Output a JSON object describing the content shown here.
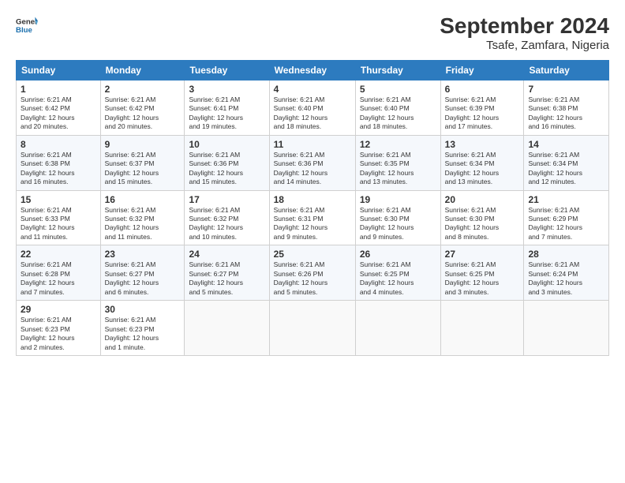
{
  "header": {
    "logo_line1": "General",
    "logo_line2": "Blue",
    "title": "September 2024",
    "subtitle": "Tsafe, Zamfara, Nigeria"
  },
  "columns": [
    "Sunday",
    "Monday",
    "Tuesday",
    "Wednesday",
    "Thursday",
    "Friday",
    "Saturday"
  ],
  "weeks": [
    [
      {
        "day": "1",
        "info": "Sunrise: 6:21 AM\nSunset: 6:42 PM\nDaylight: 12 hours\nand 20 minutes."
      },
      {
        "day": "2",
        "info": "Sunrise: 6:21 AM\nSunset: 6:42 PM\nDaylight: 12 hours\nand 20 minutes."
      },
      {
        "day": "3",
        "info": "Sunrise: 6:21 AM\nSunset: 6:41 PM\nDaylight: 12 hours\nand 19 minutes."
      },
      {
        "day": "4",
        "info": "Sunrise: 6:21 AM\nSunset: 6:40 PM\nDaylight: 12 hours\nand 18 minutes."
      },
      {
        "day": "5",
        "info": "Sunrise: 6:21 AM\nSunset: 6:40 PM\nDaylight: 12 hours\nand 18 minutes."
      },
      {
        "day": "6",
        "info": "Sunrise: 6:21 AM\nSunset: 6:39 PM\nDaylight: 12 hours\nand 17 minutes."
      },
      {
        "day": "7",
        "info": "Sunrise: 6:21 AM\nSunset: 6:38 PM\nDaylight: 12 hours\nand 16 minutes."
      }
    ],
    [
      {
        "day": "8",
        "info": "Sunrise: 6:21 AM\nSunset: 6:38 PM\nDaylight: 12 hours\nand 16 minutes."
      },
      {
        "day": "9",
        "info": "Sunrise: 6:21 AM\nSunset: 6:37 PM\nDaylight: 12 hours\nand 15 minutes."
      },
      {
        "day": "10",
        "info": "Sunrise: 6:21 AM\nSunset: 6:36 PM\nDaylight: 12 hours\nand 15 minutes."
      },
      {
        "day": "11",
        "info": "Sunrise: 6:21 AM\nSunset: 6:36 PM\nDaylight: 12 hours\nand 14 minutes."
      },
      {
        "day": "12",
        "info": "Sunrise: 6:21 AM\nSunset: 6:35 PM\nDaylight: 12 hours\nand 13 minutes."
      },
      {
        "day": "13",
        "info": "Sunrise: 6:21 AM\nSunset: 6:34 PM\nDaylight: 12 hours\nand 13 minutes."
      },
      {
        "day": "14",
        "info": "Sunrise: 6:21 AM\nSunset: 6:34 PM\nDaylight: 12 hours\nand 12 minutes."
      }
    ],
    [
      {
        "day": "15",
        "info": "Sunrise: 6:21 AM\nSunset: 6:33 PM\nDaylight: 12 hours\nand 11 minutes."
      },
      {
        "day": "16",
        "info": "Sunrise: 6:21 AM\nSunset: 6:32 PM\nDaylight: 12 hours\nand 11 minutes."
      },
      {
        "day": "17",
        "info": "Sunrise: 6:21 AM\nSunset: 6:32 PM\nDaylight: 12 hours\nand 10 minutes."
      },
      {
        "day": "18",
        "info": "Sunrise: 6:21 AM\nSunset: 6:31 PM\nDaylight: 12 hours\nand 9 minutes."
      },
      {
        "day": "19",
        "info": "Sunrise: 6:21 AM\nSunset: 6:30 PM\nDaylight: 12 hours\nand 9 minutes."
      },
      {
        "day": "20",
        "info": "Sunrise: 6:21 AM\nSunset: 6:30 PM\nDaylight: 12 hours\nand 8 minutes."
      },
      {
        "day": "21",
        "info": "Sunrise: 6:21 AM\nSunset: 6:29 PM\nDaylight: 12 hours\nand 7 minutes."
      }
    ],
    [
      {
        "day": "22",
        "info": "Sunrise: 6:21 AM\nSunset: 6:28 PM\nDaylight: 12 hours\nand 7 minutes."
      },
      {
        "day": "23",
        "info": "Sunrise: 6:21 AM\nSunset: 6:27 PM\nDaylight: 12 hours\nand 6 minutes."
      },
      {
        "day": "24",
        "info": "Sunrise: 6:21 AM\nSunset: 6:27 PM\nDaylight: 12 hours\nand 5 minutes."
      },
      {
        "day": "25",
        "info": "Sunrise: 6:21 AM\nSunset: 6:26 PM\nDaylight: 12 hours\nand 5 minutes."
      },
      {
        "day": "26",
        "info": "Sunrise: 6:21 AM\nSunset: 6:25 PM\nDaylight: 12 hours\nand 4 minutes."
      },
      {
        "day": "27",
        "info": "Sunrise: 6:21 AM\nSunset: 6:25 PM\nDaylight: 12 hours\nand 3 minutes."
      },
      {
        "day": "28",
        "info": "Sunrise: 6:21 AM\nSunset: 6:24 PM\nDaylight: 12 hours\nand 3 minutes."
      }
    ],
    [
      {
        "day": "29",
        "info": "Sunrise: 6:21 AM\nSunset: 6:23 PM\nDaylight: 12 hours\nand 2 minutes."
      },
      {
        "day": "30",
        "info": "Sunrise: 6:21 AM\nSunset: 6:23 PM\nDaylight: 12 hours\nand 1 minute."
      },
      null,
      null,
      null,
      null,
      null
    ]
  ]
}
